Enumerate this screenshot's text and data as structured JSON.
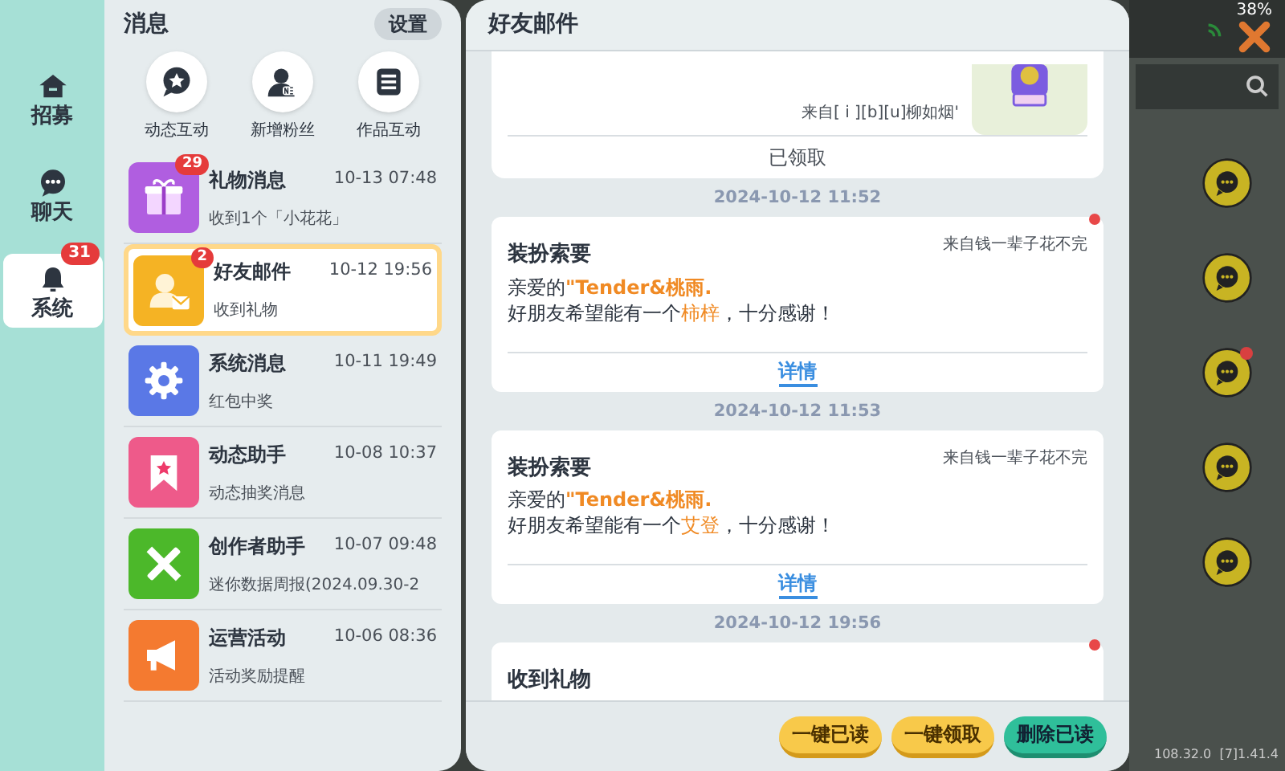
{
  "status_bar": {
    "battery": "38%"
  },
  "nav": [
    {
      "label": "招募",
      "selected": false
    },
    {
      "label": "聊天",
      "selected": false
    },
    {
      "label": "系统",
      "selected": true,
      "badge": "31"
    }
  ],
  "messages": {
    "title": "消息",
    "settings_button": "设置",
    "shortcuts": [
      {
        "label": "动态互动"
      },
      {
        "label": "新增粉丝"
      },
      {
        "label": "作品互动"
      }
    ],
    "items": [
      {
        "title": "礼物消息",
        "time": "10-13 07:48",
        "preview": "收到1个「小花花」",
        "color": "#b05ee0",
        "badge": "29",
        "selected": false
      },
      {
        "title": "好友邮件",
        "time": "10-12 19:56",
        "preview": "收到礼物",
        "color": "#f5b324",
        "badge": "2",
        "selected": true
      },
      {
        "title": "系统消息",
        "time": "10-11 19:49",
        "preview": "红包中奖",
        "color": "#5a78e6",
        "selected": false
      },
      {
        "title": "动态助手",
        "time": "10-08 10:37",
        "preview": "动态抽奖消息",
        "color": "#ee5a8a",
        "selected": false
      },
      {
        "title": "创作者助手",
        "time": "10-07 09:48",
        "preview": "迷你数据周报(2024.09.30-2",
        "color": "#4cb82a",
        "selected": false
      },
      {
        "title": "运营活动",
        "time": "10-06 08:36",
        "preview": "活动奖励提醒",
        "color": "#f47a30",
        "selected": false
      }
    ]
  },
  "mail": {
    "title": "好友邮件",
    "top_card": {
      "sender": "来自[ i ][b][u]柳如烟'",
      "status": "已领取"
    },
    "entries": [
      {
        "timestamp": "2024-10-12 11:52",
        "kind": "request",
        "title": "装扮索要",
        "sender": "来自钱一辈子花不完",
        "unread": true,
        "greeting": "亲爱的",
        "name": "\"Tender&桃雨.",
        "line_prefix": "好朋友希望能有一个",
        "item": "柿梓",
        "line_suffix": "，十分感谢！",
        "link": "详情"
      },
      {
        "timestamp": "2024-10-12 11:53",
        "kind": "request",
        "title": "装扮索要",
        "sender": "来自钱一辈子花不完",
        "unread": false,
        "greeting": "亲爱的",
        "name": "\"Tender&桃雨.",
        "line_prefix": "好朋友希望能有一个",
        "item": "艾登",
        "line_suffix": "，十分感谢！",
        "link": "详情"
      },
      {
        "timestamp": "2024-10-12 19:56",
        "kind": "gift",
        "title": "收到礼物",
        "unread": true
      }
    ],
    "buttons": [
      {
        "label": "一键已读",
        "kind": "yellow"
      },
      {
        "label": "一键领取",
        "kind": "yellow"
      },
      {
        "label": "删除已读",
        "kind": "green"
      }
    ]
  },
  "background": {
    "chat_buttons": [
      {
        "unread": false
      },
      {
        "unread": false
      },
      {
        "unread": true
      },
      {
        "unread": false
      },
      {
        "unread": false
      }
    ],
    "version": "108.32.0  [7]1.41.4"
  }
}
